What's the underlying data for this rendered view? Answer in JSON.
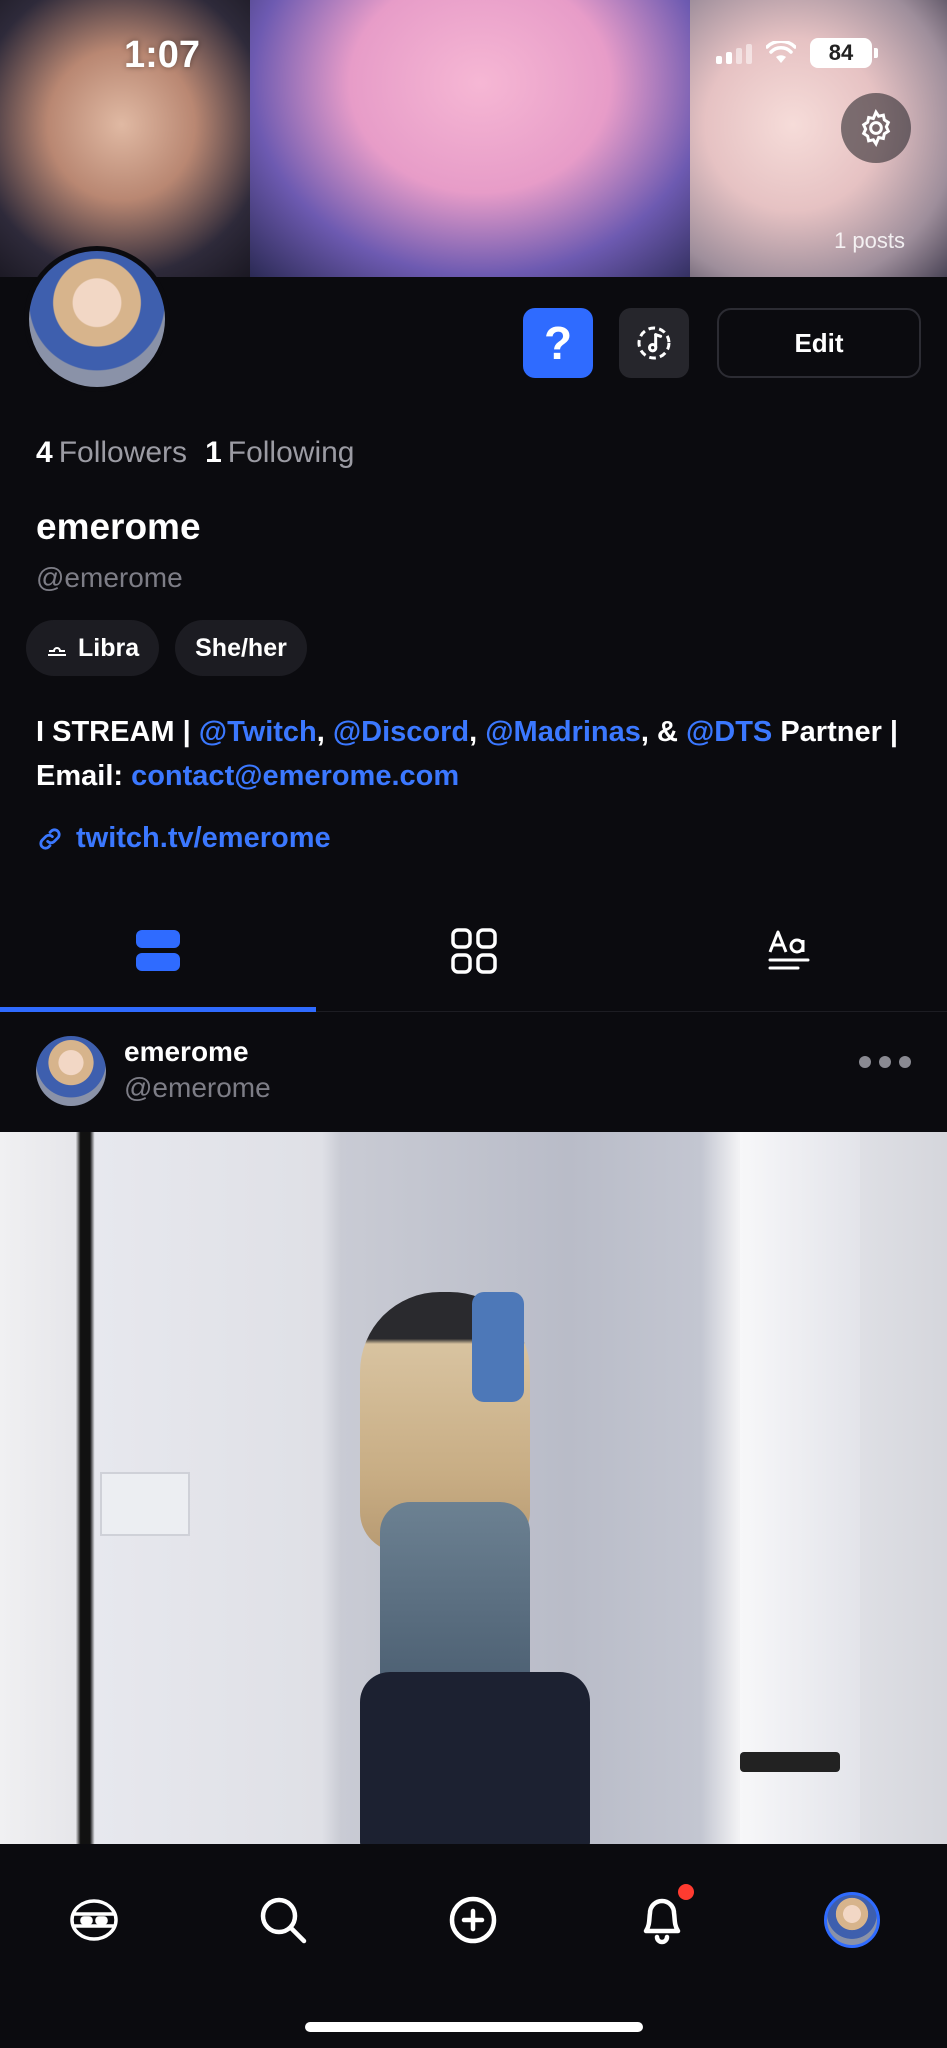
{
  "status_bar": {
    "time": "1:07",
    "battery": "84"
  },
  "banner": {
    "posts_count": "1 posts"
  },
  "profile": {
    "followers_count": "4",
    "followers_label": "Followers",
    "following_count": "1",
    "following_label": "Following",
    "display_name": "emerome",
    "handle": "@emerome",
    "chips": [
      "Libra",
      "She/her"
    ],
    "bio": {
      "p1": "I STREAM | ",
      "m1": "@Twitch",
      "p2": ", ",
      "m2": "@Discord",
      "p3": ", ",
      "m3": "@Madrinas",
      "p4": ", & ",
      "m4": "@DTS",
      "p5": " Partner |",
      "email_label": "Email: ",
      "email": "contact@emerome.com"
    },
    "link": "twitch.tv/emerome"
  },
  "actions": {
    "help_label": "?",
    "edit_label": "Edit"
  },
  "tabs": [
    "posts-list",
    "grid",
    "text"
  ],
  "post": {
    "name": "emerome",
    "handle": "@emerome"
  },
  "colors": {
    "accent": "#2f6bff",
    "link": "#3b78ff",
    "background": "#0b0b0f",
    "notification": "#ff3b30"
  }
}
